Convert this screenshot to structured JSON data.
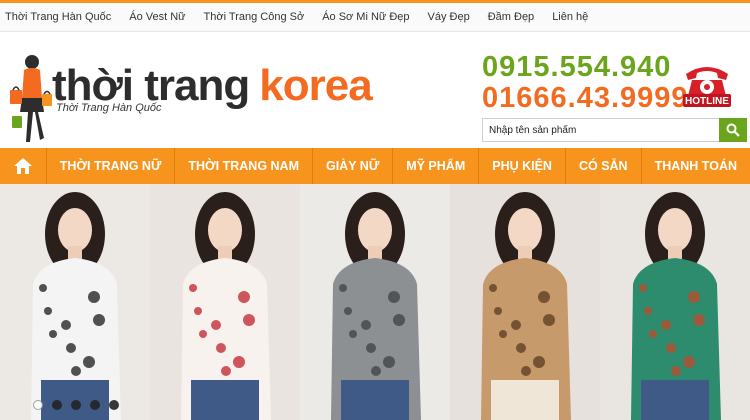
{
  "top_nav": {
    "links": [
      "Thời Trang Hàn Quốc",
      "Áo Vest Nữ",
      "Thời Trang Công Sở",
      "Áo Sơ Mi Nữ Đẹp",
      "Váy Đẹp",
      "Đầm Đẹp",
      "Liên hệ"
    ]
  },
  "header": {
    "logo": {
      "word1": "thời trang",
      "word2": "korea",
      "tagline": "Thời Trang Hàn Quốc"
    },
    "hotline": {
      "phone1": "0915.554.940",
      "phone2": "01666.43.9999",
      "badge": "HOTLINE"
    },
    "search": {
      "placeholder": "Nhập tên sản phẩm",
      "value": ""
    }
  },
  "main_nav": {
    "home_icon": "home-icon",
    "items": [
      "THỜI TRANG NỮ",
      "THỜI TRANG NAM",
      "GIÀY NỮ",
      "MỸ PHẨM",
      "PHỤ KIỆN",
      "CÓ SẴN",
      "THANH TOÁN"
    ]
  },
  "banner": {
    "slides": [
      {
        "name": "model-white-print-shirt",
        "top_color": "#f4f4f4",
        "accent": "#1a1a1a"
      },
      {
        "name": "model-rose-print-shirt",
        "top_color": "#f7f2ee",
        "accent": "#c0202a"
      },
      {
        "name": "model-grey-ruffle-blouse",
        "top_color": "#8d9092",
        "accent": "#3d4245"
      },
      {
        "name": "model-leopard-blouse",
        "top_color": "#c79a6c",
        "accent": "#5a3a20"
      },
      {
        "name": "model-green-geometric-shirt",
        "top_color": "#2e8c6e",
        "accent": "#c04a2a"
      }
    ],
    "active_dot": 0,
    "dot_count": 5
  },
  "colors": {
    "brand_orange": "#f7941d",
    "logo_orange": "#f26b21",
    "brand_green": "#6ba51d",
    "hotline_red": "#d8202a"
  }
}
